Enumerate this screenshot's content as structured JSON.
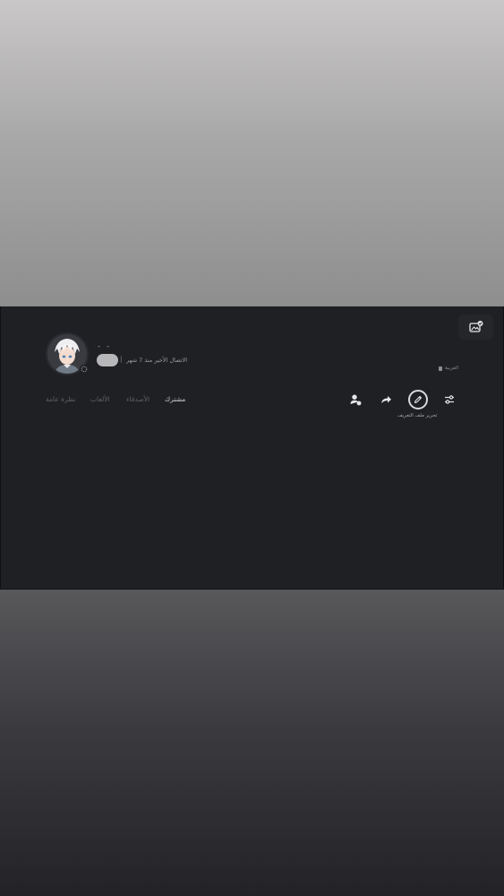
{
  "profile": {
    "display_name": "- -",
    "last_online": "الاتصال الأخير منذ 7 شهر",
    "separator": "|",
    "region": "العربية"
  },
  "tabs": [
    {
      "label": "مشترك",
      "active": true
    },
    {
      "label": "الأصدقاء",
      "active": false
    },
    {
      "label": "الألعاب",
      "active": false
    },
    {
      "label": "نظرة عامة",
      "active": false
    }
  ],
  "actions": {
    "edit_profile_label": "تحرير ملف التعريف"
  },
  "icons": {
    "banner_edit": "image-check-icon",
    "settings": "sliders-icon",
    "edit": "pencil-icon",
    "share": "share-arrow-icon",
    "add_friend": "add-user-icon"
  },
  "colors": {
    "panel_bg": "#1f2024",
    "active_tab": "#d2d3d6",
    "inactive_tab": "#5f6065"
  }
}
